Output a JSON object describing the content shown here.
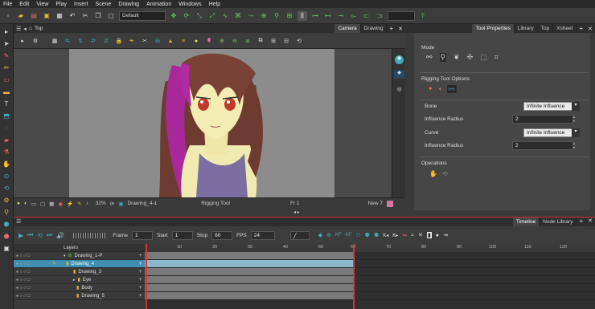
{
  "menu": [
    "File",
    "Edit",
    "View",
    "Play",
    "Insert",
    "Scene",
    "Drawing",
    "Animation",
    "Windows",
    "Help"
  ],
  "toolbar": {
    "mode_select": "Default"
  },
  "viewport": {
    "top_tab": "Top",
    "tabs": [
      "Camera",
      "Drawing"
    ],
    "status": {
      "zoom": "32%",
      "drawing": "Drawing_4-1",
      "tool": "Rigging Tool",
      "frame": "Fr 1",
      "new": "New 7"
    }
  },
  "tool_properties": {
    "tabs": [
      "Tool Properties",
      "Library",
      "Top",
      "Xsheet"
    ],
    "mode_label": "Mode",
    "rigging_label": "Rigging Tool Options",
    "bone_label": "Bone",
    "bone_value": "Infinite Influence",
    "bone_radius_label": "Influence Radius",
    "bone_radius": "2",
    "curve_label": "Curve",
    "curve_value": "Infinite Influence",
    "curve_radius_label": "Influence Radius",
    "curve_radius": "2",
    "operations_label": "Operations"
  },
  "timeline": {
    "tabs": [
      "Timeline",
      "Node Library"
    ],
    "frame_label": "Frame",
    "frame": "1",
    "start_label": "Start",
    "start": "1",
    "stop_label": "Stop",
    "stop": "60",
    "fps_label": "FPS",
    "fps": "24",
    "layers_header": "Layers",
    "layers": [
      "Drawing_1-P",
      "Drawing_4",
      "Drawing_3",
      "Eye",
      "Body",
      "Drawing_5"
    ],
    "ruler": [
      "10",
      "20",
      "30",
      "40",
      "50",
      "60",
      "70",
      "80",
      "90",
      "100",
      "110",
      "120"
    ]
  },
  "colors": {
    "accent": "#3aa0c8",
    "selected_layer": "#3e8fb0"
  }
}
